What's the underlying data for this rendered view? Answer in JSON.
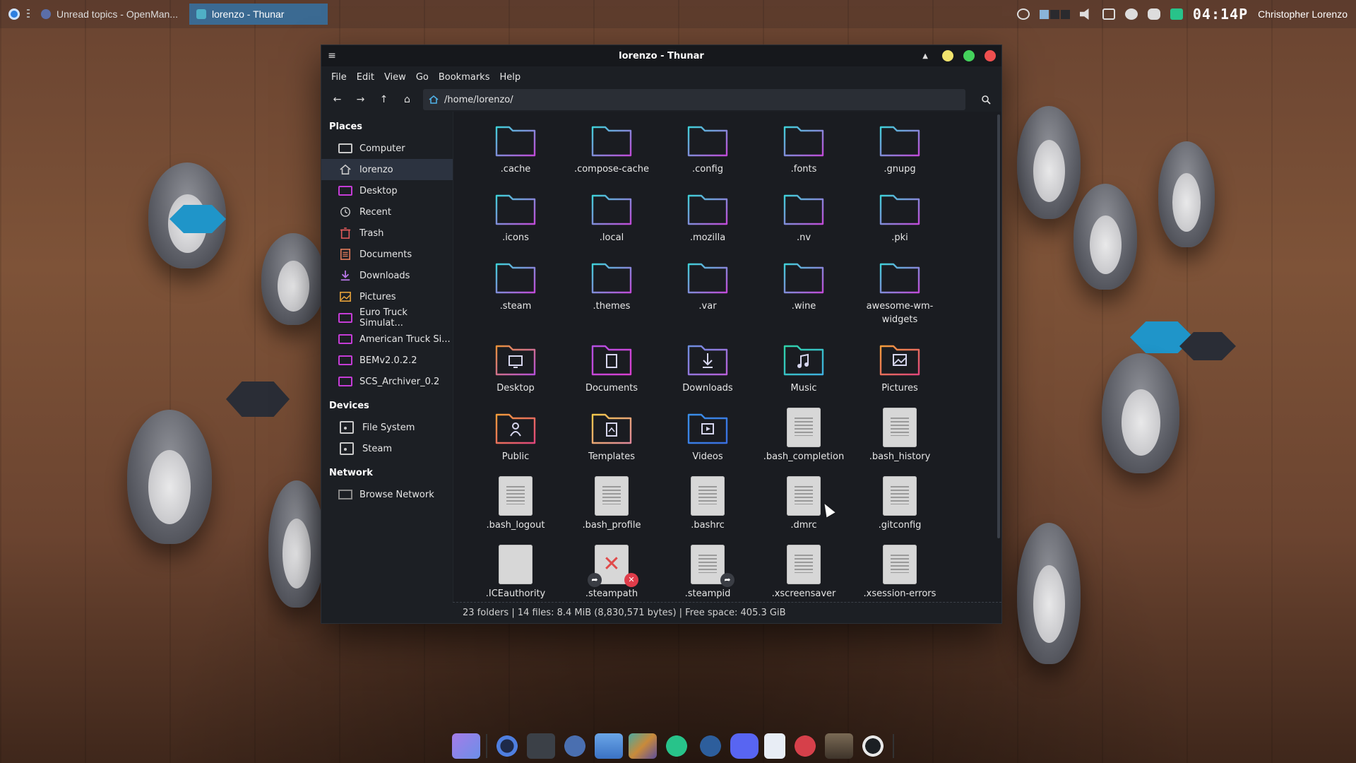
{
  "taskbar": {
    "tasks": [
      {
        "label": "Unread topics - OpenMan..."
      },
      {
        "label": "lorenzo - Thunar"
      }
    ],
    "clock": "04:14P",
    "user": "Christopher Lorenzo"
  },
  "window": {
    "title": "lorenzo - Thunar",
    "menu": [
      "File",
      "Edit",
      "View",
      "Go",
      "Bookmarks",
      "Help"
    ],
    "location": "/home/lorenzo/"
  },
  "sidebar": {
    "places_heading": "Places",
    "places": [
      {
        "label": "Computer",
        "icon": "computer-icon"
      },
      {
        "label": "lorenzo",
        "icon": "home-icon",
        "active": true
      },
      {
        "label": "Desktop",
        "icon": "desktop-icon"
      },
      {
        "label": "Recent",
        "icon": "recent-icon"
      },
      {
        "label": "Trash",
        "icon": "trash-icon"
      },
      {
        "label": "Documents",
        "icon": "documents-icon"
      },
      {
        "label": "Downloads",
        "icon": "downloads-icon"
      },
      {
        "label": "Pictures",
        "icon": "pictures-icon"
      },
      {
        "label": "Euro Truck Simulat...",
        "icon": "folder-icon"
      },
      {
        "label": "American Truck Si...",
        "icon": "folder-icon"
      },
      {
        "label": "BEMv2.0.2.2",
        "icon": "folder-icon"
      },
      {
        "label": "SCS_Archiver_0.2",
        "icon": "folder-icon"
      }
    ],
    "devices_heading": "Devices",
    "devices": [
      {
        "label": "File System",
        "icon": "drive-icon"
      },
      {
        "label": "Steam",
        "icon": "drive-icon"
      }
    ],
    "network_heading": "Network",
    "network": [
      {
        "label": "Browse Network",
        "icon": "network-icon"
      }
    ]
  },
  "files": [
    {
      "name": ".cache",
      "kind": "folder"
    },
    {
      "name": ".compose-cache",
      "kind": "folder"
    },
    {
      "name": ".config",
      "kind": "folder"
    },
    {
      "name": ".fonts",
      "kind": "folder"
    },
    {
      "name": ".gnupg",
      "kind": "folder"
    },
    {
      "name": ".icons",
      "kind": "folder"
    },
    {
      "name": ".local",
      "kind": "folder"
    },
    {
      "name": ".mozilla",
      "kind": "folder"
    },
    {
      "name": ".nv",
      "kind": "folder"
    },
    {
      "name": ".pki",
      "kind": "folder"
    },
    {
      "name": ".steam",
      "kind": "folder"
    },
    {
      "name": ".themes",
      "kind": "folder"
    },
    {
      "name": ".var",
      "kind": "folder"
    },
    {
      "name": ".wine",
      "kind": "folder"
    },
    {
      "name": "awesome-wm-widgets",
      "kind": "folder"
    },
    {
      "name": "Desktop",
      "kind": "folder-desktop"
    },
    {
      "name": "Documents",
      "kind": "folder-documents"
    },
    {
      "name": "Downloads",
      "kind": "folder-downloads"
    },
    {
      "name": "Music",
      "kind": "folder-music"
    },
    {
      "name": "Pictures",
      "kind": "folder-pictures"
    },
    {
      "name": "Public",
      "kind": "folder-public"
    },
    {
      "name": "Templates",
      "kind": "folder-templates"
    },
    {
      "name": "Videos",
      "kind": "folder-videos"
    },
    {
      "name": ".bash_completion",
      "kind": "text"
    },
    {
      "name": ".bash_history",
      "kind": "text"
    },
    {
      "name": ".bash_logout",
      "kind": "text"
    },
    {
      "name": ".bash_profile",
      "kind": "text"
    },
    {
      "name": ".bashrc",
      "kind": "text"
    },
    {
      "name": ".dmrc",
      "kind": "text"
    },
    {
      "name": ".gitconfig",
      "kind": "text"
    },
    {
      "name": ".ICEauthority",
      "kind": "blank"
    },
    {
      "name": ".steampath",
      "kind": "broken-link"
    },
    {
      "name": ".steampid",
      "kind": "link"
    },
    {
      "name": ".xscreensaver",
      "kind": "text"
    },
    {
      "name": ".xsession-errors",
      "kind": "text"
    }
  ],
  "status": "23 folders  |  14 files: 8.4 MiB (8,830,571 bytes)  |  Free space: 405.3 GiB",
  "colors": {
    "folder_gradient_start": "#3fd0d8",
    "folder_gradient_end": "#c04ad8",
    "accent_active": "#2c3340"
  }
}
